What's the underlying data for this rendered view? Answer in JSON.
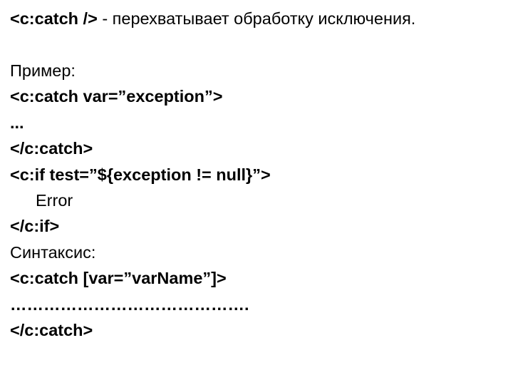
{
  "lines": [
    {
      "bold": "<c:catch />",
      "rest": " - перехватывает обработку исключения."
    },
    {
      "blank": true
    },
    {
      "plain": "Пример:"
    },
    {
      "bold": "<c:catch var=”exception”>"
    },
    {
      "bold": "..."
    },
    {
      "bold": "</c:catch>"
    },
    {
      "bold": "<c:if test=”${exception != null}”>"
    },
    {
      "indent": true,
      "plain": "Error"
    },
    {
      "bold": "</c:if>"
    },
    {
      "plain": "Синтаксис:"
    },
    {
      "bold": "<c:catch [var=”varName”]>"
    },
    {
      "bold": "……………………………………."
    },
    {
      "bold": "</c:catch>"
    }
  ]
}
